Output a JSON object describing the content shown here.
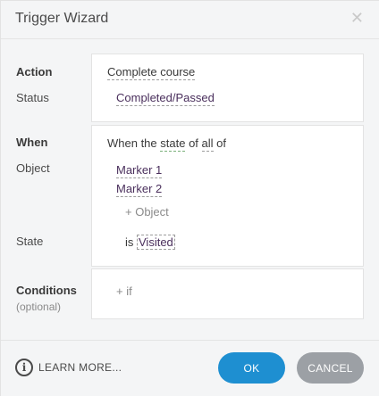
{
  "dialog": {
    "title": "Trigger Wizard",
    "close_glyph": "✕"
  },
  "action_section": {
    "action_label": "Action",
    "action_value": "Complete course",
    "status_label": "Status",
    "status_value": "Completed/Passed"
  },
  "when_section": {
    "when_label": "When",
    "sentence": {
      "part1": "When the ",
      "state_word": "state",
      "part2": " of ",
      "all_word": "all",
      "part3": " of"
    },
    "object_label": "Object",
    "objects": [
      "Marker 1",
      "Marker 2"
    ],
    "add_object": "+ Object",
    "state_label": "State",
    "state_prefix": "is ",
    "state_value": "Visited"
  },
  "conditions_section": {
    "label": "Conditions",
    "sublabel": "(optional)",
    "add_if": "+ if"
  },
  "footer": {
    "learn_more": "LEARN MORE...",
    "info_glyph": "i",
    "ok_label": "OK",
    "cancel_label": "CANCEL"
  },
  "colors": {
    "primary_button": "#1e8fd1",
    "secondary_button": "#9ca0a5",
    "value_purple": "#4a2f5c"
  }
}
